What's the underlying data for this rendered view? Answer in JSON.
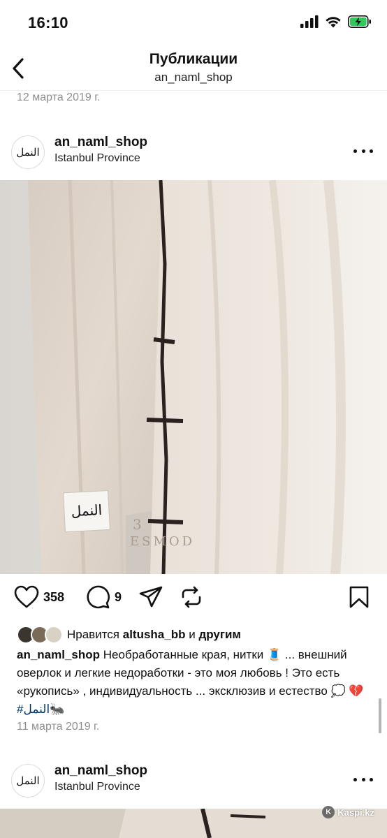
{
  "status_bar": {
    "time": "16:10"
  },
  "nav": {
    "title": "Публикации",
    "subtitle": "an_naml_shop"
  },
  "previous_post": {
    "date": "12 марта 2019 г."
  },
  "post": {
    "username": "an_naml_shop",
    "location": "Istanbul Province",
    "label_text": "النمل",
    "stamp_text": "ESMOD",
    "stamp_number": "3",
    "likes_count": "358",
    "comments_count": "9",
    "liked_by_prefix": "Нравится",
    "liked_by_user": "altusha_bb",
    "liked_by_and": "и",
    "liked_by_others": "другим",
    "caption_user": "an_naml_shop",
    "caption_text": "Необработанные края, нитки 🧵 ... внешний оверлок и легкие недоработки - это моя любовь ! Это есть «рукопись» , индивидуальность ... эксклюзив и естество 💭 💔",
    "caption_hashtag": "#النمل🐜",
    "date": "11 марта 2019 г."
  },
  "next_post": {
    "username": "an_naml_shop",
    "location": "Istanbul Province"
  },
  "avatar_logo": "النمل",
  "watermark": {
    "text": "Kaspi.kz"
  },
  "icons": {
    "back": "chevron-left-icon",
    "like": "heart-icon",
    "comment": "comment-bubble-icon",
    "share": "paper-plane-icon",
    "repost": "repost-icon",
    "save": "bookmark-icon",
    "more": "more-dots-icon"
  },
  "colors": {
    "hashtag": "#00376b",
    "secondary_text": "#8e8e8e",
    "battery": "#34c759"
  }
}
